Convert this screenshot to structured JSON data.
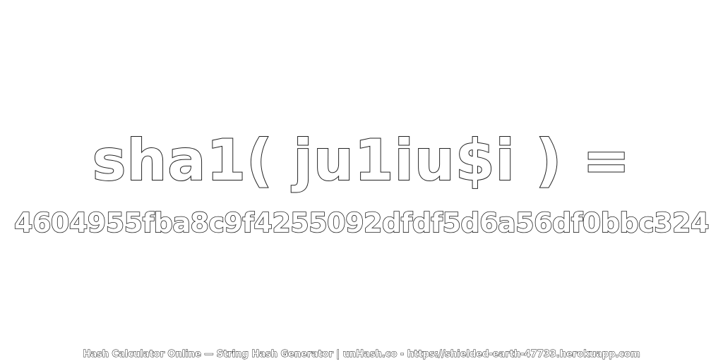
{
  "headline": "sha1( ju1iu$i ) =",
  "digest": "4604955fba8c9f4255092dfdf5d6a56df0bbc324",
  "footer": "Hash Calculator Online — String Hash Generator | unHash.co - https://shielded-earth-47733.herokuapp.com"
}
